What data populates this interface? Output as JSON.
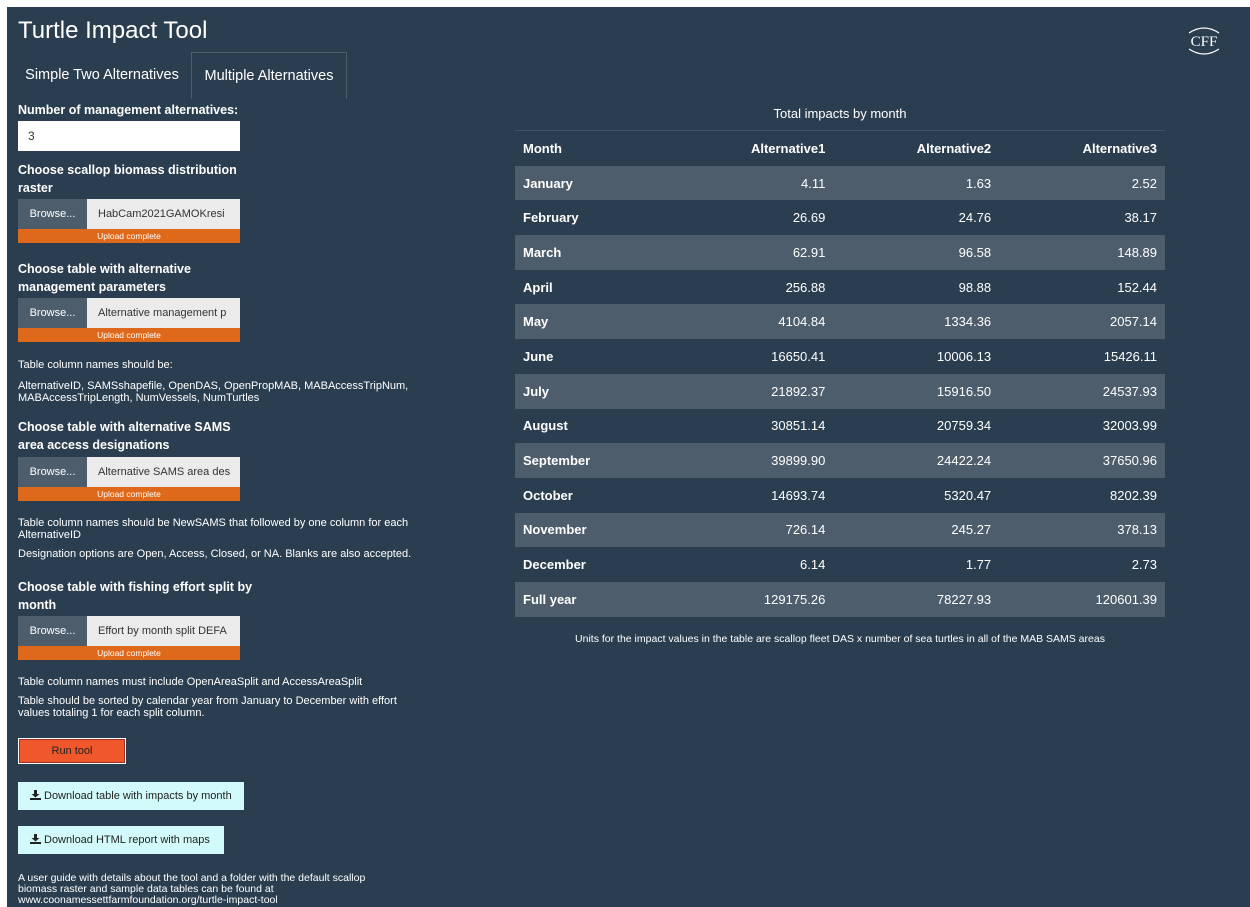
{
  "app": {
    "title": "Turtle Impact Tool",
    "logo_text": "CFF"
  },
  "tabs": [
    {
      "label": "Simple Two Alternatives"
    },
    {
      "label": "Multiple Alternatives"
    }
  ],
  "form": {
    "num_alternatives_label": "Number of management alternatives:",
    "num_alternatives_value": "3",
    "raster": {
      "label_line1": "Choose scallop biomass distribution",
      "label_line2": "raster",
      "browse": "Browse...",
      "filename": "HabCam2021GAMOKresi",
      "status": "Upload complete"
    },
    "params": {
      "label_line1": "Choose table with alternative",
      "label_line2": "management parameters",
      "browse": "Browse...",
      "filename": "Alternative management p",
      "status": "Upload complete",
      "help1": "Table column names should be:",
      "help2": "AlternativeID, SAMSshapefile, OpenDAS, OpenPropMAB, MABAccessTripNum,",
      "help3": "MABAccessTripLength, NumVessels, NumTurtles"
    },
    "sams": {
      "label_line1": "Choose table with alternative SAMS",
      "label_line2": "area access designations",
      "browse": "Browse...",
      "filename": "Alternative SAMS area des",
      "status": "Upload complete",
      "help1": "Table column names should be NewSAMS that followed by one column for each",
      "help2": "AlternativeID",
      "help3": "Designation options are Open, Access, Closed, or NA. Blanks are also accepted."
    },
    "effort": {
      "label_line1": "Choose table with fishing effort split by",
      "label_line2": "month",
      "browse": "Browse...",
      "filename": "Effort by month split DEFA",
      "status": "Upload complete",
      "help1": "Table column names must include OpenAreaSplit and AccessAreaSplit",
      "help2": "Table should be sorted by calendar year from January to December with effort",
      "help3": "values totaling 1 for each split column."
    },
    "run_label": "Run tool",
    "download_table_label": "Download table with impacts by month",
    "download_report_label": "Download HTML report with maps",
    "footer1": "A user guide with details about the tool and a folder with the default scallop",
    "footer2": "biomass raster and sample data tables can be found at",
    "footer3": "www.coonamessettfarmfoundation.org/turtle-impact-tool"
  },
  "impacts": {
    "title": "Total impacts by month",
    "columns": [
      "Month",
      "Alternative1",
      "Alternative2",
      "Alternative3"
    ],
    "rows": [
      [
        "January",
        "4.11",
        "1.63",
        "2.52"
      ],
      [
        "February",
        "26.69",
        "24.76",
        "38.17"
      ],
      [
        "March",
        "62.91",
        "96.58",
        "148.89"
      ],
      [
        "April",
        "256.88",
        "98.88",
        "152.44"
      ],
      [
        "May",
        "4104.84",
        "1334.36",
        "2057.14"
      ],
      [
        "June",
        "16650.41",
        "10006.13",
        "15426.11"
      ],
      [
        "July",
        "21892.37",
        "15916.50",
        "24537.93"
      ],
      [
        "August",
        "30851.14",
        "20759.34",
        "32003.99"
      ],
      [
        "September",
        "39899.90",
        "24422.24",
        "37650.96"
      ],
      [
        "October",
        "14693.74",
        "5320.47",
        "8202.39"
      ],
      [
        "November",
        "726.14",
        "245.27",
        "378.13"
      ],
      [
        "December",
        "6.14",
        "1.77",
        "2.73"
      ],
      [
        "Full year",
        "129175.26",
        "78227.93",
        "120601.39"
      ]
    ],
    "units_note": "Units for the impact values in the table are scallop fleet DAS x number of sea turtles in all of the MAB SAMS areas"
  },
  "colors": {
    "background": "#2b3e50",
    "row_stripe": "#4e5d6c",
    "accent_orange": "#df691a",
    "run_button": "#f0572a",
    "download_button": "#d2fafa"
  }
}
